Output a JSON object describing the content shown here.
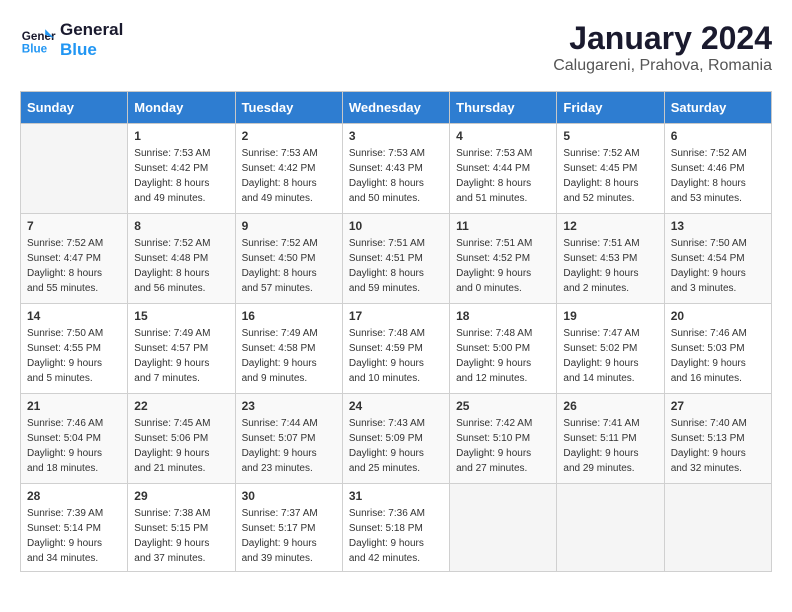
{
  "logo": {
    "line1": "General",
    "line2": "Blue"
  },
  "title": "January 2024",
  "location": "Calugareni, Prahova, Romania",
  "days_header": [
    "Sunday",
    "Monday",
    "Tuesday",
    "Wednesday",
    "Thursday",
    "Friday",
    "Saturday"
  ],
  "weeks": [
    [
      {
        "num": "",
        "sunrise": "",
        "sunset": "",
        "daylight": ""
      },
      {
        "num": "1",
        "sunrise": "Sunrise: 7:53 AM",
        "sunset": "Sunset: 4:42 PM",
        "daylight": "Daylight: 8 hours and 49 minutes."
      },
      {
        "num": "2",
        "sunrise": "Sunrise: 7:53 AM",
        "sunset": "Sunset: 4:42 PM",
        "daylight": "Daylight: 8 hours and 49 minutes."
      },
      {
        "num": "3",
        "sunrise": "Sunrise: 7:53 AM",
        "sunset": "Sunset: 4:43 PM",
        "daylight": "Daylight: 8 hours and 50 minutes."
      },
      {
        "num": "4",
        "sunrise": "Sunrise: 7:53 AM",
        "sunset": "Sunset: 4:44 PM",
        "daylight": "Daylight: 8 hours and 51 minutes."
      },
      {
        "num": "5",
        "sunrise": "Sunrise: 7:52 AM",
        "sunset": "Sunset: 4:45 PM",
        "daylight": "Daylight: 8 hours and 52 minutes."
      },
      {
        "num": "6",
        "sunrise": "Sunrise: 7:52 AM",
        "sunset": "Sunset: 4:46 PM",
        "daylight": "Daylight: 8 hours and 53 minutes."
      }
    ],
    [
      {
        "num": "7",
        "sunrise": "Sunrise: 7:52 AM",
        "sunset": "Sunset: 4:47 PM",
        "daylight": "Daylight: 8 hours and 55 minutes."
      },
      {
        "num": "8",
        "sunrise": "Sunrise: 7:52 AM",
        "sunset": "Sunset: 4:48 PM",
        "daylight": "Daylight: 8 hours and 56 minutes."
      },
      {
        "num": "9",
        "sunrise": "Sunrise: 7:52 AM",
        "sunset": "Sunset: 4:50 PM",
        "daylight": "Daylight: 8 hours and 57 minutes."
      },
      {
        "num": "10",
        "sunrise": "Sunrise: 7:51 AM",
        "sunset": "Sunset: 4:51 PM",
        "daylight": "Daylight: 8 hours and 59 minutes."
      },
      {
        "num": "11",
        "sunrise": "Sunrise: 7:51 AM",
        "sunset": "Sunset: 4:52 PM",
        "daylight": "Daylight: 9 hours and 0 minutes."
      },
      {
        "num": "12",
        "sunrise": "Sunrise: 7:51 AM",
        "sunset": "Sunset: 4:53 PM",
        "daylight": "Daylight: 9 hours and 2 minutes."
      },
      {
        "num": "13",
        "sunrise": "Sunrise: 7:50 AM",
        "sunset": "Sunset: 4:54 PM",
        "daylight": "Daylight: 9 hours and 3 minutes."
      }
    ],
    [
      {
        "num": "14",
        "sunrise": "Sunrise: 7:50 AM",
        "sunset": "Sunset: 4:55 PM",
        "daylight": "Daylight: 9 hours and 5 minutes."
      },
      {
        "num": "15",
        "sunrise": "Sunrise: 7:49 AM",
        "sunset": "Sunset: 4:57 PM",
        "daylight": "Daylight: 9 hours and 7 minutes."
      },
      {
        "num": "16",
        "sunrise": "Sunrise: 7:49 AM",
        "sunset": "Sunset: 4:58 PM",
        "daylight": "Daylight: 9 hours and 9 minutes."
      },
      {
        "num": "17",
        "sunrise": "Sunrise: 7:48 AM",
        "sunset": "Sunset: 4:59 PM",
        "daylight": "Daylight: 9 hours and 10 minutes."
      },
      {
        "num": "18",
        "sunrise": "Sunrise: 7:48 AM",
        "sunset": "Sunset: 5:00 PM",
        "daylight": "Daylight: 9 hours and 12 minutes."
      },
      {
        "num": "19",
        "sunrise": "Sunrise: 7:47 AM",
        "sunset": "Sunset: 5:02 PM",
        "daylight": "Daylight: 9 hours and 14 minutes."
      },
      {
        "num": "20",
        "sunrise": "Sunrise: 7:46 AM",
        "sunset": "Sunset: 5:03 PM",
        "daylight": "Daylight: 9 hours and 16 minutes."
      }
    ],
    [
      {
        "num": "21",
        "sunrise": "Sunrise: 7:46 AM",
        "sunset": "Sunset: 5:04 PM",
        "daylight": "Daylight: 9 hours and 18 minutes."
      },
      {
        "num": "22",
        "sunrise": "Sunrise: 7:45 AM",
        "sunset": "Sunset: 5:06 PM",
        "daylight": "Daylight: 9 hours and 21 minutes."
      },
      {
        "num": "23",
        "sunrise": "Sunrise: 7:44 AM",
        "sunset": "Sunset: 5:07 PM",
        "daylight": "Daylight: 9 hours and 23 minutes."
      },
      {
        "num": "24",
        "sunrise": "Sunrise: 7:43 AM",
        "sunset": "Sunset: 5:09 PM",
        "daylight": "Daylight: 9 hours and 25 minutes."
      },
      {
        "num": "25",
        "sunrise": "Sunrise: 7:42 AM",
        "sunset": "Sunset: 5:10 PM",
        "daylight": "Daylight: 9 hours and 27 minutes."
      },
      {
        "num": "26",
        "sunrise": "Sunrise: 7:41 AM",
        "sunset": "Sunset: 5:11 PM",
        "daylight": "Daylight: 9 hours and 29 minutes."
      },
      {
        "num": "27",
        "sunrise": "Sunrise: 7:40 AM",
        "sunset": "Sunset: 5:13 PM",
        "daylight": "Daylight: 9 hours and 32 minutes."
      }
    ],
    [
      {
        "num": "28",
        "sunrise": "Sunrise: 7:39 AM",
        "sunset": "Sunset: 5:14 PM",
        "daylight": "Daylight: 9 hours and 34 minutes."
      },
      {
        "num": "29",
        "sunrise": "Sunrise: 7:38 AM",
        "sunset": "Sunset: 5:15 PM",
        "daylight": "Daylight: 9 hours and 37 minutes."
      },
      {
        "num": "30",
        "sunrise": "Sunrise: 7:37 AM",
        "sunset": "Sunset: 5:17 PM",
        "daylight": "Daylight: 9 hours and 39 minutes."
      },
      {
        "num": "31",
        "sunrise": "Sunrise: 7:36 AM",
        "sunset": "Sunset: 5:18 PM",
        "daylight": "Daylight: 9 hours and 42 minutes."
      },
      {
        "num": "",
        "sunrise": "",
        "sunset": "",
        "daylight": ""
      },
      {
        "num": "",
        "sunrise": "",
        "sunset": "",
        "daylight": ""
      },
      {
        "num": "",
        "sunrise": "",
        "sunset": "",
        "daylight": ""
      }
    ]
  ]
}
